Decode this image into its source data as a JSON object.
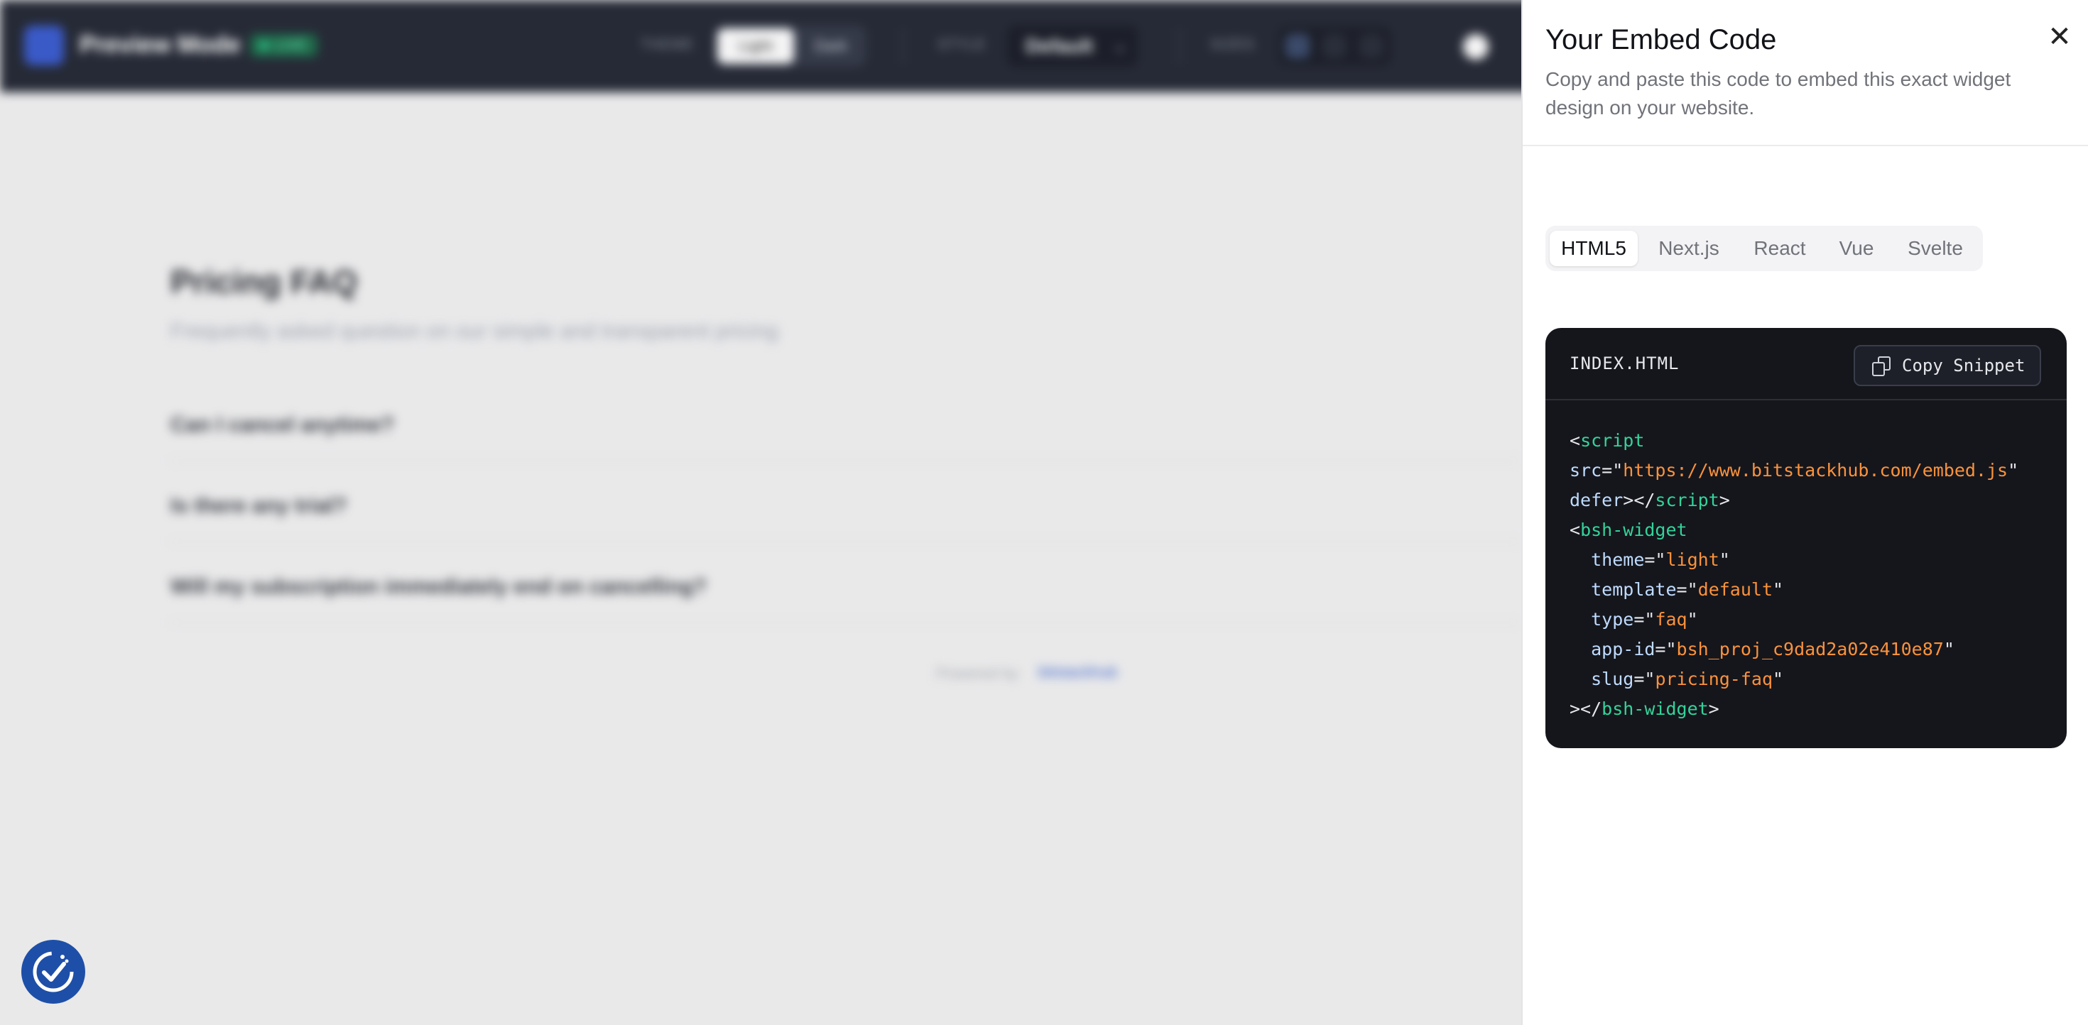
{
  "background": {
    "app_title": "Preview Mode",
    "badge": "LIVE",
    "toolbar": {
      "theme_label": "THEME",
      "theme_options": [
        "Light",
        "Dark"
      ],
      "style_label": "STYLE",
      "style_value": "Default",
      "sizes_label": "SIZES"
    },
    "faq": {
      "title": "Pricing FAQ",
      "subtitle": "Frequently asked question on our simple and transparent pricing",
      "questions": [
        "Can I cancel anytime?",
        "Is there any trial?",
        "Will my subscription immediately end on cancelling?"
      ],
      "powered_by": "Powered by",
      "brand": "bitstackhub"
    }
  },
  "drawer": {
    "title": "Your Embed Code",
    "subtitle": "Copy and paste this code to embed this exact widget design on your website.",
    "tabs": [
      "HTML5",
      "Next.js",
      "React",
      "Vue",
      "Svelte"
    ],
    "active_tab": "HTML5",
    "file_name": "INDEX.HTML",
    "copy_label": "Copy Snippet",
    "code": {
      "script_tag": "script",
      "src_attr": "src",
      "src_value": "https://www.bitstackhub.com/embed.js",
      "defer_attr": "defer",
      "widget_tag": "bsh-widget",
      "attrs": [
        {
          "name": "theme",
          "value": "light"
        },
        {
          "name": "template",
          "value": "default"
        },
        {
          "name": "type",
          "value": "faq"
        },
        {
          "name": "app-id",
          "value": "bsh_proj_c9dad2a02e410e87"
        },
        {
          "name": "slug",
          "value": "pricing-faq"
        }
      ]
    }
  },
  "colors": {
    "accent_blue": "#1e4fa8",
    "code_bg": "#15161c",
    "code_tag": "#34d399",
    "code_string": "#fb923c",
    "code_attr": "#bfdbfe"
  }
}
